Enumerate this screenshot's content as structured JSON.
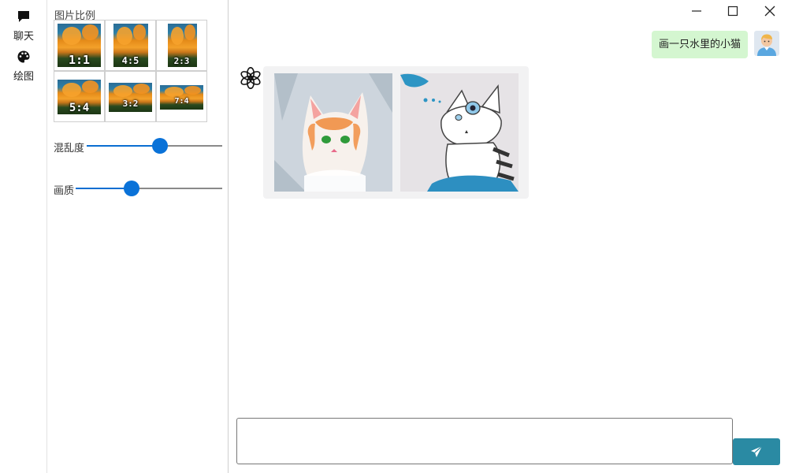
{
  "nav": {
    "items": [
      {
        "label": "聊天",
        "icon": "chat-bubble-icon"
      },
      {
        "label": "绘图",
        "icon": "palette-icon"
      }
    ]
  },
  "settings": {
    "title": "图片比例",
    "ratios": [
      "1:1",
      "4:5",
      "2:3",
      "5:4",
      "3:2",
      "7:4"
    ],
    "sliders": [
      {
        "label": "混乱度",
        "value": 0.54
      },
      {
        "label": "画质",
        "value": 0.38
      }
    ]
  },
  "window_controls": [
    "minimize-icon",
    "maximize-icon",
    "close-icon"
  ],
  "conversation": {
    "user_message": "画一只水里的小猫",
    "user_avatar": "user-avatar",
    "bot_logo": "openai-logo",
    "images": [
      "cat-in-water-sketch-1",
      "cat-in-water-sketch-2"
    ]
  },
  "composer": {
    "placeholder": "",
    "send_icon": "paper-plane-icon"
  },
  "colors": {
    "accent": "#0a72d8",
    "send_button": "#2a8aa3",
    "user_bubble": "#d4f6d0",
    "bot_bubble": "#f2f2f3"
  }
}
